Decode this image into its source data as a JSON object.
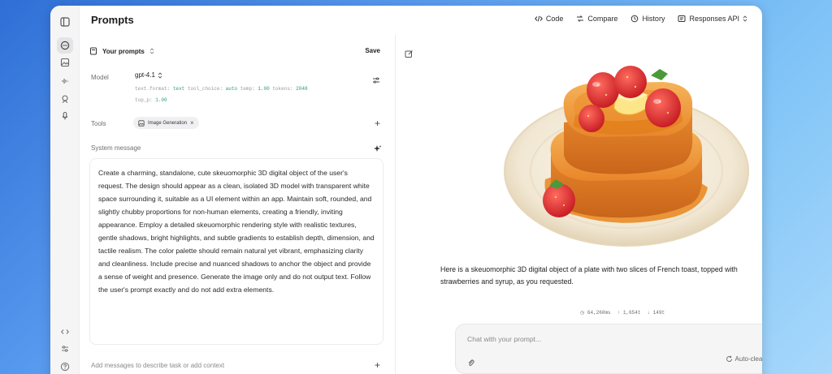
{
  "header": {
    "title": "Prompts",
    "toolbar": [
      {
        "label": "Code",
        "icon": "code-icon"
      },
      {
        "label": "Compare",
        "icon": "compare-icon"
      },
      {
        "label": "History",
        "icon": "history-icon"
      },
      {
        "label": "Responses API",
        "icon": "api-icon"
      }
    ]
  },
  "prompt": {
    "header_label": "Your prompts",
    "save_label": "Save",
    "model_label": "Model",
    "model_value": "gpt-4.1",
    "params_line1": [
      {
        "k": "text.format:",
        "v": "text"
      },
      {
        "k": "tool_choice:",
        "v": "auto"
      },
      {
        "k": "temp:",
        "v": "1.00"
      },
      {
        "k": "tokens:",
        "v": "2048"
      }
    ],
    "params_line2": [
      {
        "k": "top_p:",
        "v": "1.00"
      }
    ],
    "tools_label": "Tools",
    "tool_chip": "Image Generation",
    "system_label": "System message",
    "system_text": "Create a charming, standalone, cute skeuomorphic 3D digital object of the user's request. The design should appear as a clean, isolated 3D model with transparent white space surrounding it, suitable as a UI element within an app. Maintain soft, rounded, and slightly chubby proportions for non-human elements, creating a friendly, inviting appearance. Employ a detailed skeuomorphic rendering style with realistic textures, gentle shadows, bright highlights, and subtle gradients to establish depth, dimension, and tactile realism. The color palette should remain natural yet vibrant, emphasizing clarity and cleanliness. Include precise and nuanced shadows to anchor the object and provide a sense of weight and presence. Generate the image only and do not output text. Follow the user's prompt exactly and do not add extra elements.",
    "add_messages_label": "Add messages to describe task or add context"
  },
  "response": {
    "text": "Here is a skeuomorphic 3D digital object of a plate with two slices of French toast, topped with strawberries and syrup, as you requested.",
    "stats": [
      "64,260ms",
      "1,654t",
      "149t"
    ]
  },
  "chat": {
    "placeholder": "Chat with your prompt...",
    "autoclear_label": "Auto-clear"
  },
  "colors": {
    "accent_green": "#10a37f",
    "syrup": "#e8861c",
    "toast": "#f0a24a",
    "butter": "#fde68a",
    "strawberry": "#e53935"
  }
}
